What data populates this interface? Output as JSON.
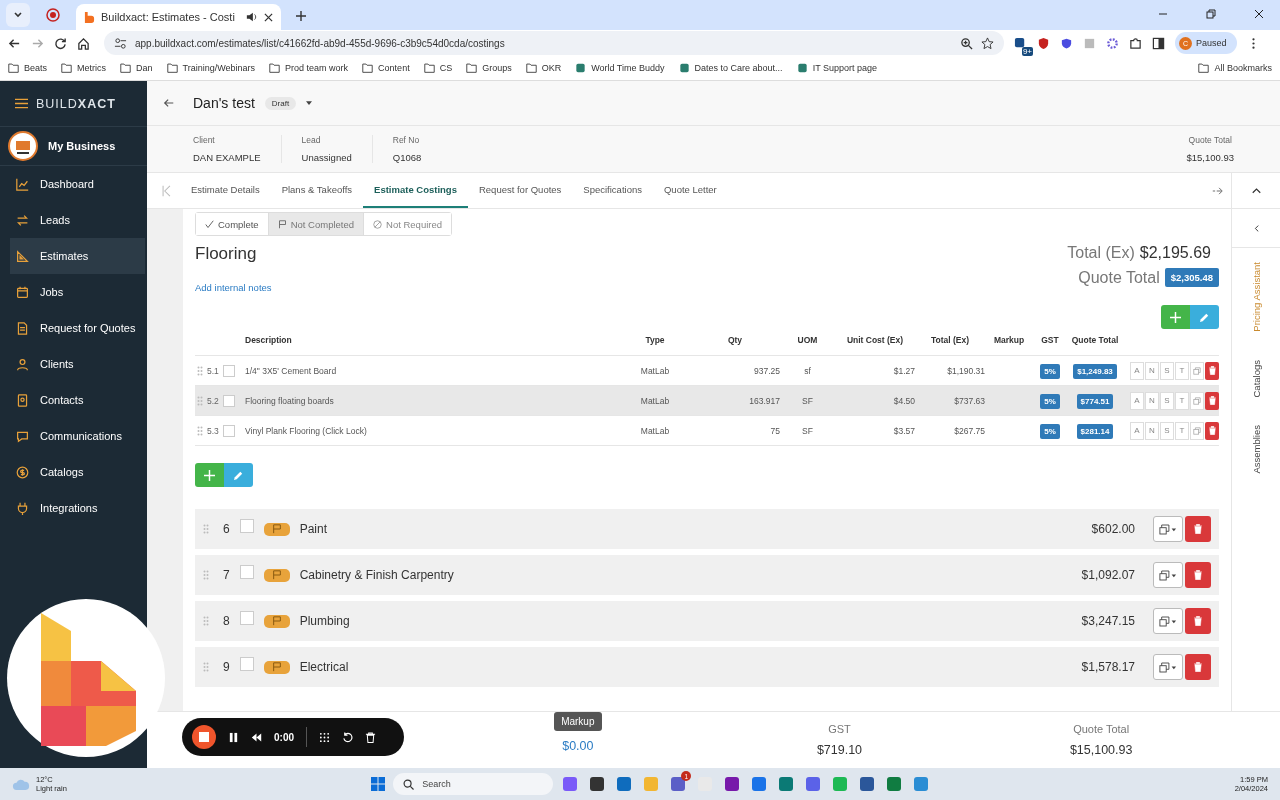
{
  "browser": {
    "tabs": [
      {
        "title": "Buildxact: Estimates - Costi",
        "selected": true
      }
    ],
    "url": "app.buildxact.com/estimates/list/c41662fd-ab9d-455d-9696-c3b9c54d0cda/costings",
    "extension_badge": "9+",
    "profile": {
      "initial": "C",
      "label": "Paused"
    },
    "bookmarks": [
      {
        "label": "Beats",
        "kind": "folder"
      },
      {
        "label": "Metrics",
        "kind": "folder"
      },
      {
        "label": "Dan",
        "kind": "folder"
      },
      {
        "label": "Training/Webinars",
        "kind": "folder"
      },
      {
        "label": "Prod team work",
        "kind": "folder"
      },
      {
        "label": "Content",
        "kind": "folder"
      },
      {
        "label": "CS",
        "kind": "folder"
      },
      {
        "label": "Groups",
        "kind": "folder"
      },
      {
        "label": "OKR",
        "kind": "folder"
      },
      {
        "label": "World Time Buddy",
        "kind": "link"
      },
      {
        "label": "Dates to Care about...",
        "kind": "link"
      },
      {
        "label": "IT Support page",
        "kind": "link"
      }
    ],
    "all_bookmarks": "All Bookmarks"
  },
  "app": {
    "brand": "BUILD**XACT**",
    "business": "My Business",
    "nav": [
      {
        "label": "Dashboard",
        "selected": false
      },
      {
        "label": "Leads",
        "selected": false
      },
      {
        "label": "Estimates",
        "selected": true
      },
      {
        "label": "Jobs",
        "selected": false
      },
      {
        "label": "Request for Quotes",
        "selected": false
      },
      {
        "label": "Clients",
        "selected": false
      },
      {
        "label": "Contacts",
        "selected": false
      },
      {
        "label": "Communications",
        "selected": false
      },
      {
        "label": "Catalogs",
        "selected": false
      },
      {
        "label": "Integrations",
        "selected": false
      }
    ]
  },
  "header": {
    "title": "Dan's test",
    "status": "Draft",
    "fields": [
      {
        "label": "Client",
        "value": "DAN EXAMPLE"
      },
      {
        "label": "Lead",
        "value": "Unassigned"
      },
      {
        "label": "Ref No",
        "value": "Q1068"
      }
    ],
    "quote_total": {
      "label": "Quote Total",
      "value": "$15,100.93"
    }
  },
  "tabs": [
    {
      "label": "Estimate Details",
      "selected": false
    },
    {
      "label": "Plans & Takeoffs",
      "selected": false
    },
    {
      "label": "Estimate Costings",
      "selected": true
    },
    {
      "label": "Request for Quotes",
      "selected": false
    },
    {
      "label": "Specifications",
      "selected": false
    },
    {
      "label": "Quote Letter",
      "selected": false
    }
  ],
  "status_buttons": [
    {
      "label": "Complete",
      "kind": "check",
      "selected": false
    },
    {
      "label": "Not Completed",
      "kind": "flag",
      "selected": true
    },
    {
      "label": "Not Required",
      "kind": "blocked",
      "selected": false
    }
  ],
  "section": {
    "title": "Flooring",
    "notes_link": "Add internal notes",
    "total_label": "Total (Ex)",
    "total": "$2,195.69",
    "quote_total_label": "Quote Total",
    "quote_total": "$2,305.48"
  },
  "table": {
    "columns": [
      "Description",
      "Type",
      "Qty",
      "UOM",
      "Unit Cost (Ex)",
      "Total (Ex)",
      "Markup",
      "GST",
      "Quote Total"
    ],
    "rows": [
      {
        "number": "5.1",
        "checked": false,
        "actions": [
          "A",
          "N",
          "S",
          "T"
        ],
        "description": "1/4\" 3X5' Cement Board",
        "type": "MatLab",
        "qty": "937.25",
        "uom": "sf",
        "unit_cost": "$1.27",
        "total": "$1,190.31",
        "gst": "5%",
        "quote_total": "$1,249.83",
        "highlighted": false
      },
      {
        "number": "5.2",
        "checked": false,
        "actions": [
          "A",
          "N",
          "S",
          "T"
        ],
        "description": "Flooring floating boards",
        "type": "MatLab",
        "qty": "163.917",
        "uom": "SF",
        "unit_cost": "$4.50",
        "total": "$737.63",
        "gst": "5%",
        "quote_total": "$774.51",
        "highlighted": true
      },
      {
        "number": "5.3",
        "checked": false,
        "actions": [
          "A",
          "N",
          "S",
          "T"
        ],
        "description": "Vinyl Plank Flooring (Click Lock)",
        "type": "MatLab",
        "qty": "75",
        "uom": "SF",
        "unit_cost": "$3.57",
        "total": "$267.75",
        "gst": "5%",
        "quote_total": "$281.14",
        "highlighted": false
      }
    ]
  },
  "groups": [
    {
      "number": "6",
      "name": "Paint",
      "total": "$602.00",
      "checked": false
    },
    {
      "number": "7",
      "name": "Cabinetry & Finish Carpentry",
      "total": "$1,092.07",
      "checked": false
    },
    {
      "number": "8",
      "name": "Plumbing",
      "total": "$3,247.15",
      "checked": false
    },
    {
      "number": "9",
      "name": "Electrical",
      "total": "$1,578.17",
      "checked": false
    }
  ],
  "summary": [
    {
      "label": "Markup",
      "value": "$0.00",
      "kind": "tooltip"
    },
    {
      "label": "GST",
      "value": "$719.10",
      "kind": "plain"
    },
    {
      "label": "Quote Total",
      "value": "$15,100.93",
      "kind": "plain"
    }
  ],
  "right_rail": [
    {
      "label": "Pricing Assistant",
      "selected": true
    },
    {
      "label": "Catalogs",
      "selected": false
    },
    {
      "label": "Assemblies",
      "selected": false
    }
  ],
  "recorder": {
    "time": "0:00"
  },
  "taskbar": {
    "temperature": "12°C",
    "weather": "Light rain",
    "search": "Search",
    "teams_badge": "1",
    "time": "1:59 PM",
    "date": "2/04/2024"
  }
}
